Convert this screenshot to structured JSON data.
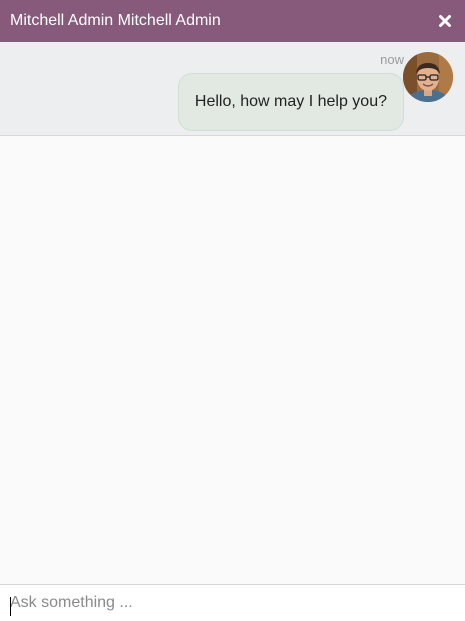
{
  "header": {
    "title": "Mitchell Admin Mitchell Admin",
    "close_icon": "close-icon"
  },
  "messages": [
    {
      "timestamp": "now",
      "text": "Hello, how may I help you?",
      "avatar_icon": "operator-avatar"
    }
  ],
  "composer": {
    "value": "",
    "placeholder": "Ask something ..."
  },
  "colors": {
    "header_bg": "#875a7b",
    "bubble_bg": "#e1e9e2",
    "message_area_bg": "#eceef0",
    "body_bg": "#fafafa"
  }
}
